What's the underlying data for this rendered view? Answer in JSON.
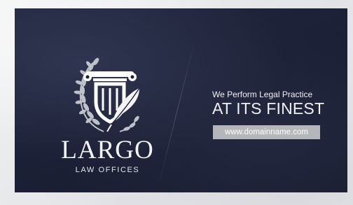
{
  "brand": {
    "name": "LARGO",
    "subtitle": "LAW OFFICES"
  },
  "tagline": {
    "line1": "We Perform Legal Practice",
    "line2": "AT ITS FINEST"
  },
  "website": "www.domainname.com",
  "colors": {
    "card_background": "#1c2036",
    "page_background": "#e9eaec",
    "text": "#f4f4f6",
    "url_box": "#b5b6b9"
  },
  "logo_icons": [
    "laurel-wreath-icon",
    "column-capital-icon",
    "shield-icon",
    "quill-feather-icon"
  ]
}
